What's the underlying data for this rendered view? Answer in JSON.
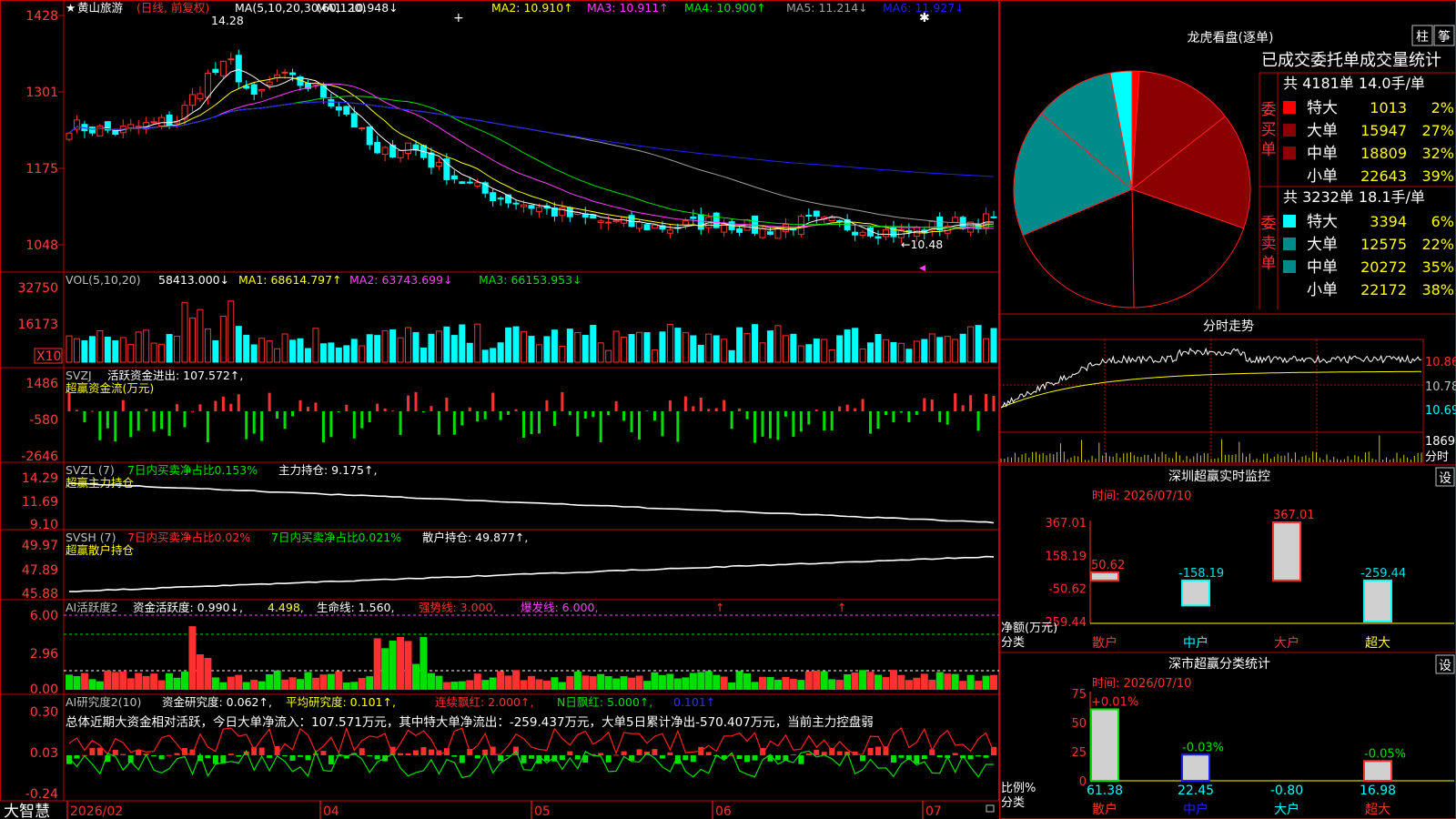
{
  "colors": {
    "up": "#ff3030",
    "down": "#00ffff",
    "bg": "#000000",
    "frame": "#c00000",
    "axis": "#ff4040",
    "ma1": "#ffffff",
    "ma2": "#ffff00",
    "ma3": "#ff40ff",
    "ma4": "#00e000",
    "ma5": "#a0a0a0",
    "ma6": "#2020ff"
  },
  "main": {
    "name": "黄山旅游",
    "mode": "(日线, 前复权)",
    "ma_label": "MA(5,10,20,30,60,120)",
    "ma_values": [
      {
        "label": "MA1:",
        "value": "10.948",
        "arrow": "↓"
      },
      {
        "label": "MA2:",
        "value": "10.910",
        "arrow": "↑"
      },
      {
        "label": "MA3:",
        "value": "10.911",
        "arrow": "↑"
      },
      {
        "label": "MA4:",
        "value": "10.900",
        "arrow": "↑"
      },
      {
        "label": "MA5:",
        "value": "11.214",
        "arrow": "↓"
      },
      {
        "label": "MA6:",
        "value": "11.927",
        "arrow": "↓"
      }
    ],
    "y_ticks": [
      "1428",
      "1301",
      "1175",
      "1048"
    ],
    "high_note": "14.28",
    "low_note": "←10.48"
  },
  "vol": {
    "title": "VOL(5,10,20)",
    "value": "58413.000↓",
    "ma1": "MA1: 68614.797↑",
    "ma2": "MA2: 63743.699↓",
    "ma3": "MA3: 66153.953↓",
    "y_ticks": [
      "32750",
      "16173"
    ],
    "unit": "X10"
  },
  "svzj": {
    "title": "SVZJ",
    "label": "活跃资金进出: 107.572↑,",
    "sub": "超赢资金流(万元)",
    "y_ticks": [
      "1486",
      "-580",
      "-2646"
    ]
  },
  "svzl": {
    "title": "SVZL (7)",
    "label1": "7日内买卖净占比0.153%",
    "label2": "主力持仓: 9.175↑,",
    "sub": "超赢主力持仓",
    "y_ticks": [
      "14.29",
      "11.69",
      "9.10"
    ]
  },
  "svsh": {
    "title": "SVSH (7)",
    "label1": "7日内买卖净占比0.02%",
    "label2": "7日内买卖净占比0.021%",
    "label3": "散户持仓: 49.877↑,",
    "sub": "超赢散户持仓",
    "y_ticks": [
      "49.97",
      "47.89",
      "45.88"
    ]
  },
  "ai1": {
    "title": "AI活跃度2",
    "label": "资金活跃度: 0.990↓,",
    "v2": "4.498,",
    "life": "生命线: 1.560,",
    "strong": "强势线: 3.000,",
    "burst": "爆发线: 6.000,",
    "y_ticks": [
      "6.00",
      "2.96",
      "0.00"
    ]
  },
  "ai2": {
    "title": "AI研究度2(10)",
    "label": "资金研究度: 0.062↑,",
    "avg": "平均研究度: 0.101↑,",
    "red": "连续飘红: 2.000↑,",
    "nred": "N日飘红: 5.000↑,",
    "last": "0.101↑",
    "y_ticks": [
      "0.30",
      "0.03",
      "-0.24"
    ],
    "summary": "总体近期大资金相对活跃，今日大单净流入：107.571万元，其中特大单净流出：-259.437万元，大单5日累计净出-570.407万元，当前主力控盘弱"
  },
  "bottom": {
    "brand": "大智慧",
    "dates": [
      "2026/02",
      "04",
      "05",
      "06",
      "07"
    ]
  },
  "dragon": {
    "title": "龙虎看盘(逐单)",
    "btn1": "柱",
    "btn2": "筝",
    "subtitle": "已成交委托单成交量统计",
    "buy": {
      "vlabel": "委买单",
      "total": "共 4181单 14.0手/单",
      "rows": [
        {
          "name": "特大",
          "vol": "1013",
          "pct": "2%",
          "color": "#ff0000"
        },
        {
          "name": "大单",
          "vol": "15947",
          "pct": "27%",
          "color": "#8b0000"
        },
        {
          "name": "中单",
          "vol": "18809",
          "pct": "32%",
          "color": "#8b0000"
        },
        {
          "name": "小单",
          "vol": "22643",
          "pct": "39%",
          "color": "#000000"
        }
      ]
    },
    "sell": {
      "vlabel": "委卖单",
      "total": "共 3232单 18.1手/单",
      "rows": [
        {
          "name": "特大",
          "vol": "3394",
          "pct": "6%",
          "color": "#00ffff"
        },
        {
          "name": "大单",
          "vol": "12575",
          "pct": "22%",
          "color": "#008b8b"
        },
        {
          "name": "中单",
          "vol": "20272",
          "pct": "35%",
          "color": "#008b8b"
        },
        {
          "name": "小单",
          "vol": "22172",
          "pct": "38%",
          "color": "#000000"
        }
      ]
    }
  },
  "intraday": {
    "title": "分时走势",
    "y_ticks": [
      "10.86",
      "10.78",
      "10.69"
    ],
    "vol_tick": "1869",
    "unit": "分时"
  },
  "monitor": {
    "title": "深圳超赢实时监控",
    "btn": "设",
    "time": "时间: 2026/07/10",
    "y_ticks": [
      "367.01",
      "158.19",
      "-50.62",
      "-259.44"
    ],
    "axis_title": "净额(万元)",
    "axis_sub": "分类",
    "bars": [
      {
        "name": "散户",
        "value": 50.62,
        "label": "50.62"
      },
      {
        "name": "中户",
        "value": -158.19,
        "label": "-158.19"
      },
      {
        "name": "大户",
        "value": 367.01,
        "label": "367.01"
      },
      {
        "name": "超大",
        "value": -259.44,
        "label": "-259.44"
      }
    ]
  },
  "classify": {
    "title": "深市超赢分类统计",
    "btn": "设",
    "time": "时间: 2026/07/10",
    "y_ticks": [
      "75",
      "50",
      "25",
      "0"
    ],
    "axis_title": "比例%",
    "axis_sub": "分类",
    "bars": [
      {
        "name": "散户",
        "value": 61.38,
        "label": "61.38",
        "top": "+0.01%"
      },
      {
        "name": "中户",
        "value": 22.45,
        "label": "22.45",
        "top": "-0.03%"
      },
      {
        "name": "大户",
        "value": -0.8,
        "label": "-0.80",
        "top": ""
      },
      {
        "name": "超大",
        "value": 16.98,
        "label": "16.98",
        "top": "-0.05%"
      }
    ]
  }
}
